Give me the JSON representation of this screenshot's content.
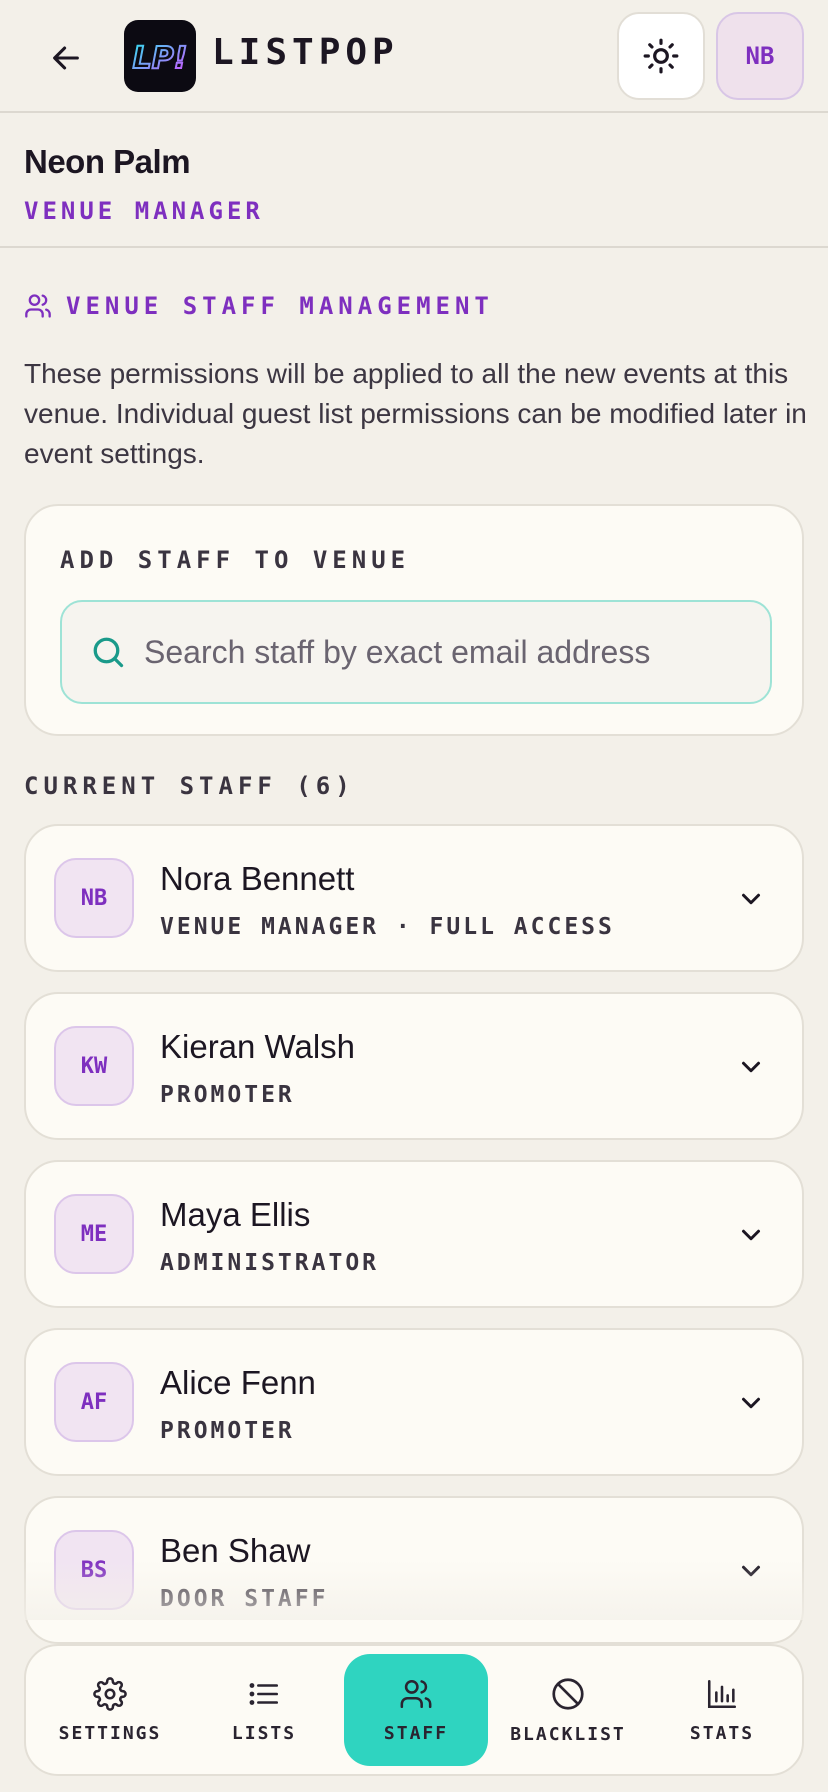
{
  "app": {
    "brand": "LISTPOP",
    "logo_text": "LP!"
  },
  "header": {
    "avatar_initials": "NB"
  },
  "venue": {
    "name": "Neon Palm",
    "role": "VENUE MANAGER"
  },
  "section": {
    "title": "VENUE STAFF MANAGEMENT",
    "description": "These permissions will be applied to all the new events at this venue. Individual guest list permissions can be modified later in event settings."
  },
  "add_staff": {
    "title": "ADD STAFF TO VENUE",
    "placeholder": "Search staff by exact email address"
  },
  "current_staff": {
    "title": "CURRENT STAFF (6)",
    "members": [
      {
        "initials": "NB",
        "name": "Nora Bennett",
        "role": "VENUE MANAGER · FULL ACCESS"
      },
      {
        "initials": "KW",
        "name": "Kieran Walsh",
        "role": "PROMOTER"
      },
      {
        "initials": "ME",
        "name": "Maya Ellis",
        "role": "ADMINISTRATOR"
      },
      {
        "initials": "AF",
        "name": "Alice Fenn",
        "role": "PROMOTER"
      },
      {
        "initials": "BS",
        "name": "Ben Shaw",
        "role": "DOOR STAFF"
      }
    ]
  },
  "nav": {
    "items": [
      {
        "label": "SETTINGS",
        "icon": "gear-icon"
      },
      {
        "label": "LISTS",
        "icon": "list-icon"
      },
      {
        "label": "STAFF",
        "icon": "users-icon",
        "active": true
      },
      {
        "label": "BLACKLIST",
        "icon": "ban-icon"
      },
      {
        "label": "STATS",
        "icon": "bar-chart-icon"
      }
    ]
  },
  "colors": {
    "accent": "#7e2fbf",
    "active_tab": "#2fd4c0",
    "background": "#f3f0e9"
  }
}
